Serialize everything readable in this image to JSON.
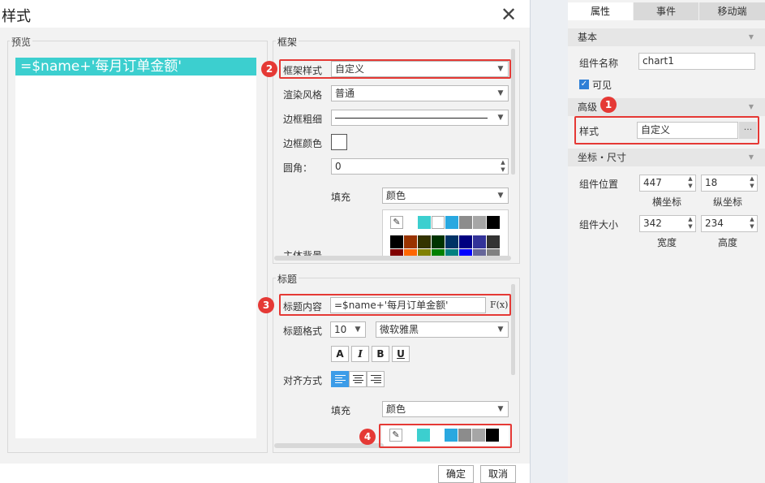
{
  "dialog": {
    "title": "样式",
    "close_glyph": "✕",
    "preview_label": "预览",
    "preview_text": "=$name+'每月订单金额'",
    "ok_label": "确定",
    "cancel_label": "取消"
  },
  "frame": {
    "group_label": "框架",
    "style_label": "框架样式",
    "style_value": "自定义",
    "render_label": "渲染风格",
    "render_value": "普通",
    "border_width_label": "边框粗细",
    "border_color_label": "边框颜色",
    "radius_label": "圆角：",
    "radius_value": "0",
    "fill_label": "填充",
    "fill_value": "颜色",
    "bg_label": "主体背景"
  },
  "title": {
    "group_label": "标题",
    "content_label": "标题内容",
    "content_value": "=$name+'每月订单金额'",
    "formula_button": "F(x)",
    "format_label": "标题格式",
    "font_size": "10",
    "font_family": "微软雅黑",
    "text_buttons": [
      "A",
      "I",
      "B",
      "U"
    ],
    "align_label": "对齐方式",
    "fill_label": "填充",
    "fill_value": "颜色"
  },
  "palette": {
    "row1": [
      "#ffffff",
      "#3ccfcf",
      "#ffffff",
      "#29a8e0",
      "#8c8c8c",
      "#a6a6a6",
      "#000000"
    ],
    "row2": [
      "#000000",
      "#993300",
      "#333300",
      "#003300",
      "#003366",
      "#000080",
      "#333399",
      "#333333"
    ],
    "row3": [
      "#800000",
      "#ff6600",
      "#808000",
      "#008000",
      "#008080",
      "#0000ff",
      "#666699",
      "#808080"
    ],
    "title_swatches": [
      "#3ccfcf",
      "#ffffff",
      "#29a8e0",
      "#8c8c8c",
      "#a6a6a6",
      "#000000"
    ]
  },
  "annotations": [
    "1",
    "2",
    "3",
    "4"
  ],
  "panel": {
    "tabs": [
      "属性",
      "事件",
      "移动端"
    ],
    "basic_label": "基本",
    "name_label": "组件名称",
    "name_value": "chart1",
    "visible_label": "可见",
    "advanced_label": "高级",
    "style_label": "样式",
    "style_value": "自定义",
    "more_glyph": "···",
    "coord_label": "坐标・尺寸",
    "position_label": "组件位置",
    "x_value": "447",
    "y_value": "18",
    "x_caption": "横坐标",
    "y_caption": "纵坐标",
    "size_label": "组件大小",
    "width_value": "342",
    "height_value": "234",
    "width_caption": "宽度",
    "height_caption": "高度"
  }
}
